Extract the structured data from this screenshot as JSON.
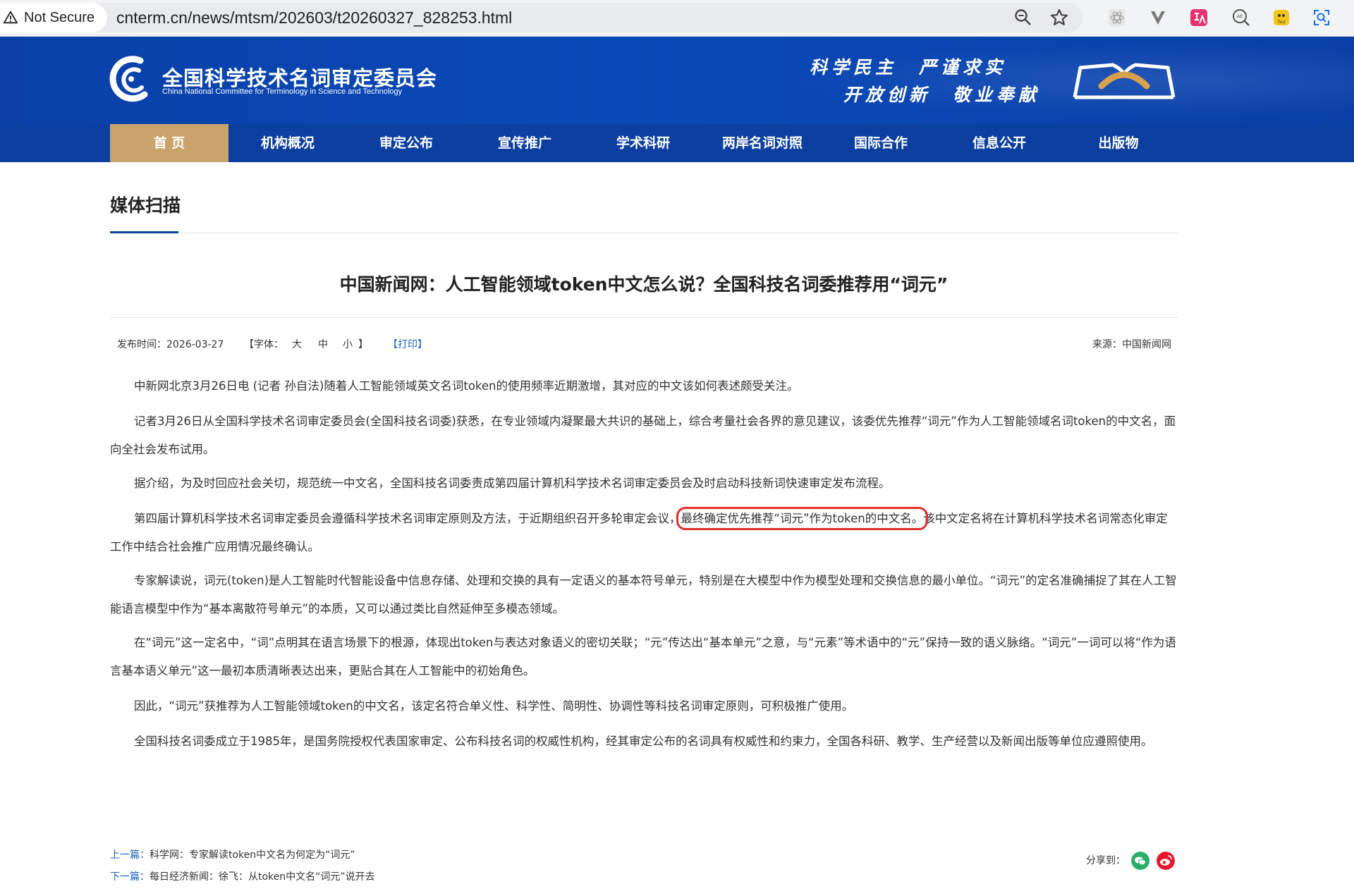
{
  "browser": {
    "security_label": "Not Secure",
    "url": "cnterm.cn/news/mtsm/202603/t20260327_828253.html"
  },
  "site": {
    "name_cn": "全国科学技术名词审定委员会",
    "name_en": "China National Committee for Terminology in Science and Technology",
    "motto_line1": "科学民主　严谨求实",
    "motto_line2": "开放创新　敬业奉献"
  },
  "nav": {
    "items": [
      "首 页",
      "机构概况",
      "审定公布",
      "宣传推广",
      "学术科研",
      "两岸名词对照",
      "国际合作",
      "信息公开",
      "出版物"
    ]
  },
  "section": {
    "title": "媒体扫描"
  },
  "article": {
    "title": "中国新闻网：人工智能领域token中文怎么说？全国科技名词委推荐用“词元”",
    "publish_label": "发布时间：2026-03-27",
    "font_label": "【字体：",
    "font_large": "大",
    "font_medium": "中",
    "font_small": "小",
    "font_close": "】",
    "print_label": "【打印】",
    "source_label": "来源：中国新闻网",
    "p1": "中新网北京3月26日电 (记者 孙自法)随着人工智能领域英文名词token的使用频率近期激增，其对应的中文该如何表述颇受关注。",
    "p2": "记者3月26日从全国科学技术名词审定委员会(全国科技名词委)获悉，在专业领域内凝聚最大共识的基础上，综合考量社会各界的意见建议，该委优先推荐“词元”作为人工智能领域名词token的中文名，面向全社会发布试用。",
    "p3": "据介绍，为及时回应社会关切，规范统一中文名，全国科技名词委责成第四届计算机科学技术名词审定委员会及时启动科技新词快速审定发布流程。",
    "p4_before": "第四届计算机科学技术名词审定委员会遵循科学技术名词审定原则及方法，于近期组织召开多轮审定会议，",
    "p4_highlight": "最终确定优先推荐“词元”作为token的中文名。",
    "p4_after": "该中文定名将在计算机科学技术名词常态化审定工作中结合社会推广应用情况最终确认。",
    "p5": "专家解读说，词元(token)是人工智能时代智能设备中信息存储、处理和交换的具有一定语义的基本符号单元，特别是在大模型中作为模型处理和交换信息的最小单位。“词元”的定名准确捕捉了其在人工智能语言模型中作为“基本离散符号单元”的本质，又可以通过类比自然延伸至多模态领域。",
    "p6": "在“词元”这一定名中，“词”点明其在语言场景下的根源，体现出token与表达对象语义的密切关联；“元”传达出“基本单元”之意，与“元素”等术语中的“元”保持一致的语义脉络。“词元”一词可以将“作为语言基本语义单元”这一最初本质清晰表达出来，更贴合其在人工智能中的初始角色。",
    "p7": "因此，“词元”获推荐为人工智能领域token的中文名，该定名符合单义性、科学性、简明性、协调性等科技名词审定原则，可积极推广使用。",
    "p8": "全国科技名词委成立于1985年，是国务院授权代表国家审定、公布科技名词的权威性机构，经其审定公布的名词具有权威性和约束力，全国各科研、教学、生产经营以及新闻出版等单位应遵照使用。"
  },
  "pager": {
    "prev_label": "上一篇：",
    "prev_title": "科学网：专家解读token中文名为何定为“词元”",
    "next_label": "下一篇：",
    "next_title": "每日经济新闻：徐飞：从token中文名“词元”说开去"
  },
  "share": {
    "label": "分享到：",
    "wechat_color": "#2aae67",
    "weibo_color": "#e6162d"
  }
}
